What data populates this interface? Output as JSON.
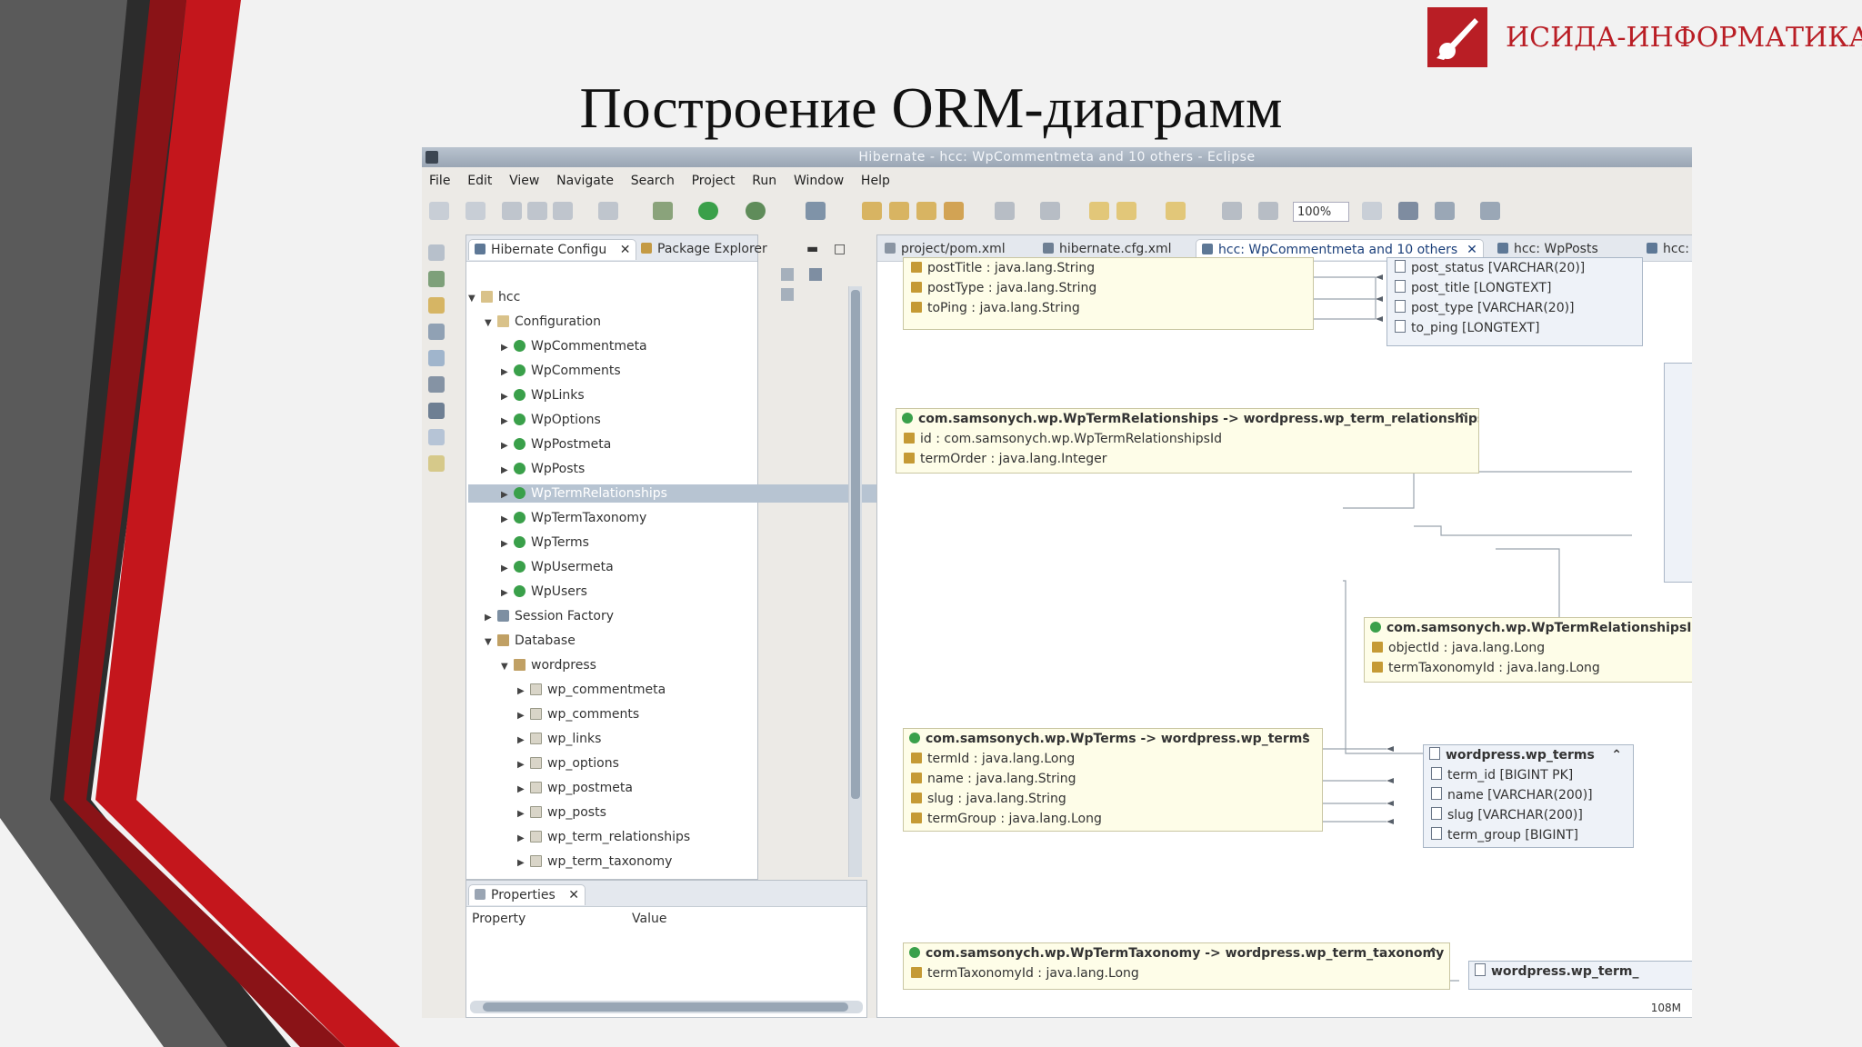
{
  "slide": {
    "brand_name": "ИСИДА-ИНФОРМАТИКА",
    "title": "Построение ORM-диаграмм",
    "brand_color": "#b91e25"
  },
  "window": {
    "title": "Hibernate - hcc: WpCommentmeta and 10 others - Eclipse"
  },
  "menu": [
    "File",
    "Edit",
    "View",
    "Navigate",
    "Search",
    "Project",
    "Run",
    "Window",
    "Help"
  ],
  "toolbar": {
    "zoom": "100%"
  },
  "left_panel": {
    "tabs": [
      {
        "label": "Hibernate Configu",
        "icon": "hibernate-icon"
      },
      {
        "label": "Package Explorer",
        "icon": "package-icon"
      }
    ],
    "tree": [
      {
        "label": "hcc",
        "depth": 0,
        "icon": "project",
        "expanded": true
      },
      {
        "label": "Configuration",
        "depth": 1,
        "icon": "folder",
        "expanded": true
      },
      {
        "label": "WpCommentmeta",
        "depth": 2,
        "icon": "class"
      },
      {
        "label": "WpComments",
        "depth": 2,
        "icon": "class"
      },
      {
        "label": "WpLinks",
        "depth": 2,
        "icon": "class"
      },
      {
        "label": "WpOptions",
        "depth": 2,
        "icon": "class"
      },
      {
        "label": "WpPostmeta",
        "depth": 2,
        "icon": "class"
      },
      {
        "label": "WpPosts",
        "depth": 2,
        "icon": "class"
      },
      {
        "label": "WpTermRelationships",
        "depth": 2,
        "icon": "class",
        "selected": true
      },
      {
        "label": "WpTermTaxonomy",
        "depth": 2,
        "icon": "class"
      },
      {
        "label": "WpTerms",
        "depth": 2,
        "icon": "class"
      },
      {
        "label": "WpUsermeta",
        "depth": 2,
        "icon": "class"
      },
      {
        "label": "WpUsers",
        "depth": 2,
        "icon": "class"
      },
      {
        "label": "Session Factory",
        "depth": 1,
        "icon": "session"
      },
      {
        "label": "Database",
        "depth": 1,
        "icon": "database",
        "expanded": true
      },
      {
        "label": "wordpress",
        "depth": 2,
        "icon": "schema",
        "expanded": true
      },
      {
        "label": "wp_commentmeta",
        "depth": 3,
        "icon": "table"
      },
      {
        "label": "wp_comments",
        "depth": 3,
        "icon": "table"
      },
      {
        "label": "wp_links",
        "depth": 3,
        "icon": "table"
      },
      {
        "label": "wp_options",
        "depth": 3,
        "icon": "table"
      },
      {
        "label": "wp_postmeta",
        "depth": 3,
        "icon": "table"
      },
      {
        "label": "wp_posts",
        "depth": 3,
        "icon": "table"
      },
      {
        "label": "wp_term_relationships",
        "depth": 3,
        "icon": "table"
      },
      {
        "label": "wp_term_taxonomy",
        "depth": 3,
        "icon": "table"
      }
    ]
  },
  "properties_panel": {
    "title": "Properties",
    "col_property": "Property",
    "col_value": "Value"
  },
  "editor_tabs": [
    {
      "label": "project/pom.xml",
      "active": false
    },
    {
      "label": "hibernate.cfg.xml",
      "active": false
    },
    {
      "label": "hcc: WpCommentmeta and 10 others",
      "active": true
    },
    {
      "label": "hcc: WpPosts",
      "active": false
    },
    {
      "label": "hcc:",
      "active": false
    }
  ],
  "diagram": {
    "posts_entity_lines": [
      "postTitle : java.lang.String",
      "postType : java.lang.String",
      "toPing : java.lang.String"
    ],
    "posts_table_lines": [
      "post_status [VARCHAR(20)]",
      "post_title [LONGTEXT]",
      "post_type [VARCHAR(20)]",
      "to_ping [LONGTEXT]"
    ],
    "termrel": {
      "header": "com.samsonych.wp.WpTermRelationships -> wordpress.wp_term_relationships",
      "lines": [
        "id : com.samsonych.wp.WpTermRelationshipsId",
        "termOrder : java.lang.Integer"
      ]
    },
    "termrel_id": {
      "header": "com.samsonych.wp.WpTermRelationshipsId",
      "lines": [
        "objectId : java.lang.Long",
        "termTaxonomyId : java.lang.Long"
      ]
    },
    "terms": {
      "header": "com.samsonych.wp.WpTerms -> wordpress.wp_terms",
      "lines": [
        "termId : java.lang.Long",
        "name : java.lang.String",
        "slug : java.lang.String",
        "termGroup : java.lang.Long"
      ]
    },
    "terms_table": {
      "header": "wordpress.wp_terms",
      "lines": [
        "term_id [BIGINT PK]",
        "name [VARCHAR(200)]",
        "slug [VARCHAR(200)]",
        "term_group [BIGINT]"
      ]
    },
    "taxonomy": {
      "header": "com.samsonych.wp.WpTermTaxonomy -> wordpress.wp_term_taxonomy",
      "lines": [
        "termTaxonomyId : java.lang.Long"
      ]
    },
    "taxonomy_table_header": "wordpress.wp_term_"
  },
  "status": {
    "memory": "108M"
  }
}
